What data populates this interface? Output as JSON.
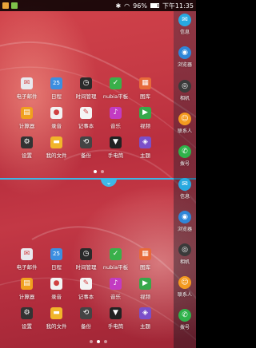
{
  "status_bar": {
    "battery": "96%",
    "time": "下午11:35"
  },
  "dock": [
    {
      "label": "信息",
      "icon": "message-icon",
      "color": "#28a9e0"
    },
    {
      "label": "浏览器",
      "icon": "browser-icon",
      "color": "#2f86d8"
    },
    {
      "label": "相机",
      "icon": "camera-icon",
      "color": "#3a3a3a"
    },
    {
      "label": "联系人",
      "icon": "contacts-icon",
      "color": "#f39a1f"
    },
    {
      "label": "拨号",
      "icon": "phone-icon",
      "color": "#2fb24a"
    }
  ],
  "dock_bottom": [
    {
      "label": "信息",
      "icon": "message-icon",
      "color": "#28a9e0"
    },
    {
      "label": "浏览器",
      "icon": "browser-icon",
      "color": "#2f86d8"
    },
    {
      "label": "相机",
      "icon": "camera-icon",
      "color": "#3a3a3a"
    },
    {
      "label": "联系人",
      "icon": "contacts-icon",
      "color": "#f39a1f"
    },
    {
      "label": "拨号",
      "icon": "phone-icon",
      "color": "#2fb24a"
    }
  ],
  "top_apps": [
    {
      "label": "电子邮件",
      "icon": "mail-icon",
      "color": "#e9e9ee",
      "glyph": "✉"
    },
    {
      "label": "日程",
      "icon": "calendar-icon",
      "color": "#3c8ee0",
      "glyph": "25"
    },
    {
      "label": "时间管理",
      "icon": "clock-icon",
      "color": "#2a2a2a",
      "glyph": "◷"
    },
    {
      "label": "nubia平板",
      "icon": "shield-icon",
      "color": "#39b04a",
      "glyph": "✓"
    },
    {
      "label": "图库",
      "icon": "gallery-icon",
      "color": "#e76a3a",
      "glyph": "▦"
    },
    {
      "label": "计算器",
      "icon": "calculator-icon",
      "color": "#f0a01e",
      "glyph": "▤"
    },
    {
      "label": "录音",
      "icon": "recorder-icon",
      "color": "#f2f2f2",
      "glyph": "●"
    },
    {
      "label": "记事本",
      "icon": "notepad-icon",
      "color": "#f4f4f4",
      "glyph": "✎"
    },
    {
      "label": "音乐",
      "icon": "music-icon",
      "color": "#c23bc2",
      "glyph": "♪"
    },
    {
      "label": "视频",
      "icon": "video-icon",
      "color": "#37a84a",
      "glyph": "▶"
    },
    {
      "label": "设置",
      "icon": "settings-icon",
      "color": "#333333",
      "glyph": "⚙"
    },
    {
      "label": "我的文件",
      "icon": "folder-icon",
      "color": "#f1b52a",
      "glyph": "▬"
    },
    {
      "label": "备份",
      "icon": "backup-icon",
      "color": "#444444",
      "glyph": "⟲"
    },
    {
      "label": "手电筒",
      "icon": "flashlight-icon",
      "color": "#222222",
      "glyph": "▼"
    },
    {
      "label": "主题",
      "icon": "theme-icon",
      "color": "#7b4fc9",
      "glyph": "◈"
    }
  ],
  "bottom_apps": [
    {
      "label": "电子邮件",
      "icon": "mail-icon",
      "color": "#e9e9ee",
      "glyph": "✉"
    },
    {
      "label": "日程",
      "icon": "calendar-icon",
      "color": "#3c8ee0",
      "glyph": "25"
    },
    {
      "label": "时间管理",
      "icon": "clock-icon",
      "color": "#2a2a2a",
      "glyph": "◷"
    },
    {
      "label": "nubia平板",
      "icon": "shield-icon",
      "color": "#39b04a",
      "glyph": "✓"
    },
    {
      "label": "图库",
      "icon": "gallery-icon",
      "color": "#e76a3a",
      "glyph": "▦"
    },
    {
      "label": "计算器",
      "icon": "calculator-icon",
      "color": "#f0a01e",
      "glyph": "▤"
    },
    {
      "label": "录音",
      "icon": "recorder-icon",
      "color": "#f2f2f2",
      "glyph": "●"
    },
    {
      "label": "记事本",
      "icon": "notepad-icon",
      "color": "#f4f4f4",
      "glyph": "✎"
    },
    {
      "label": "音乐",
      "icon": "music-icon",
      "color": "#c23bc2",
      "glyph": "♪"
    },
    {
      "label": "视频",
      "icon": "video-icon",
      "color": "#37a84a",
      "glyph": "▶"
    },
    {
      "label": "设置",
      "icon": "settings-icon",
      "color": "#333333",
      "glyph": "⚙"
    },
    {
      "label": "我的文件",
      "icon": "folder-icon",
      "color": "#f1b52a",
      "glyph": "▬"
    },
    {
      "label": "备份",
      "icon": "backup-icon",
      "color": "#444444",
      "glyph": "⟲"
    },
    {
      "label": "手电筒",
      "icon": "flashlight-icon",
      "color": "#222222",
      "glyph": "▼"
    },
    {
      "label": "主题",
      "icon": "theme-icon",
      "color": "#7b4fc9",
      "glyph": "◈"
    }
  ],
  "page_indicator_top": {
    "count": 2,
    "active": 0
  },
  "page_indicator_bottom": {
    "count": 3,
    "active": 1
  }
}
